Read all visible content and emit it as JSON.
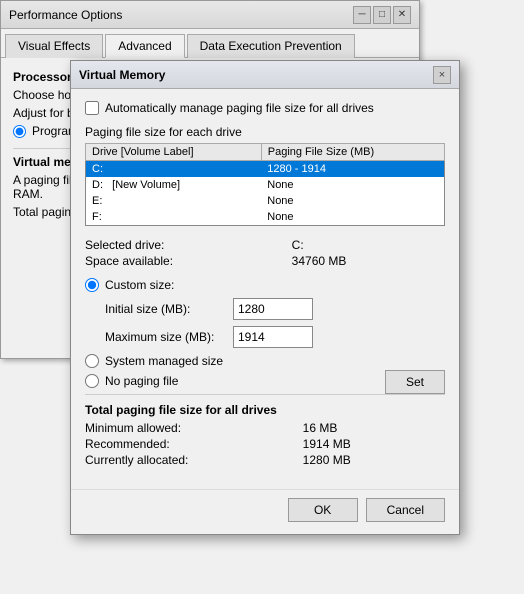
{
  "perf_window": {
    "title": "Performance Options",
    "tabs": [
      "Visual Effects",
      "Advanced",
      "Data Execution Prevention"
    ],
    "active_tab": "Advanced",
    "content": {
      "processor_label": "Processor scheduling",
      "choose_label": "Choose how to allocate processor resources.",
      "adjust_label": "Adjust for best performance of:",
      "prog_label": "Programs",
      "virtual_memory_title": "Virtual memory",
      "virtual_memory_desc": "A paging file is an area on the hard disk that Windows uses as if it were RAM.",
      "total_label": "Total paging file size:"
    }
  },
  "vm_dialog": {
    "title": "Virtual Memory",
    "close_label": "×",
    "auto_manage_label": "Automatically manage paging file size for all drives",
    "paging_label": "Paging file size for each drive",
    "table": {
      "headers": [
        "Drive  [Volume Label]",
        "Paging File Size (MB)"
      ],
      "rows": [
        {
          "drive": "C:",
          "label": "",
          "size": "1280 - 1914",
          "selected": true
        },
        {
          "drive": "D:",
          "label": "  [New Volume]",
          "size": "None",
          "selected": false
        },
        {
          "drive": "E:",
          "label": "",
          "size": "None",
          "selected": false
        },
        {
          "drive": "F:",
          "label": "",
          "size": "None",
          "selected": false
        }
      ]
    },
    "selected_drive_label": "Selected drive:",
    "selected_drive_value": "C:",
    "space_available_label": "Space available:",
    "space_available_value": "34760 MB",
    "custom_size_label": "Custom size:",
    "initial_size_label": "Initial size (MB):",
    "initial_size_value": "1280",
    "max_size_label": "Maximum size (MB):",
    "max_size_value": "1914",
    "system_managed_label": "System managed size",
    "no_paging_label": "No paging file",
    "set_label": "Set",
    "total_section_title": "Total paging file size for all drives",
    "minimum_allowed_label": "Minimum allowed:",
    "minimum_allowed_value": "16 MB",
    "recommended_label": "Recommended:",
    "recommended_value": "1914 MB",
    "currently_allocated_label": "Currently allocated:",
    "currently_allocated_value": "1280 MB",
    "ok_label": "OK",
    "cancel_label": "Cancel"
  }
}
